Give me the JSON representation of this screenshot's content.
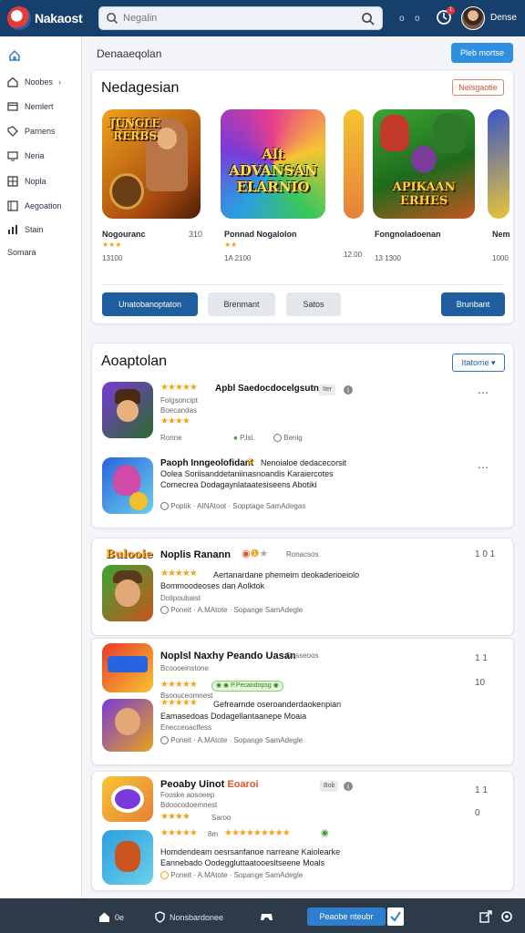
{
  "header": {
    "brand": "Nakaost",
    "search_placeholder": "Negalin",
    "dot1": "o",
    "dot2": "o",
    "notification_count": "1",
    "user_name": "Dense"
  },
  "sidebar": {
    "items": [
      {
        "label": "Noobes",
        "icon": "home-icon"
      },
      {
        "label": "Nemlert",
        "icon": "window-icon"
      },
      {
        "label": "Parnens",
        "icon": "tag-icon"
      },
      {
        "label": "Neria",
        "icon": "screen-icon"
      },
      {
        "label": "Nopla",
        "icon": "grid-icon"
      },
      {
        "label": "Aegoation",
        "icon": "list-icon"
      },
      {
        "label": "Stain",
        "icon": "chart-icon"
      },
      {
        "label": "Somara",
        "icon": ""
      }
    ]
  },
  "page": {
    "title": "Denaaeqolan",
    "top_button": "Pleb mortse"
  },
  "featured": {
    "title": "Nedagesian",
    "tag": "Nelsgaotie",
    "tiles": [
      {
        "art": "JUNGLE RERBS",
        "name": "Nogouranc",
        "num": "310",
        "meta": "13100",
        "colors": [
          "#f0a21d",
          "#7a3a10"
        ]
      },
      {
        "art": "Alt ADVANSAN ELARNIO",
        "name": "Ponnad Nogalolon",
        "num": "",
        "meta": "1A 2100",
        "colors": [
          "#d93ec7",
          "#2a63e0"
        ]
      },
      {
        "art": "",
        "name": "",
        "num": "",
        "meta": "12.00",
        "colors": [
          "#f4c430",
          "#e6803a"
        ]
      },
      {
        "art": "APIKAAN ERHES",
        "name": "Fongnoladoenan",
        "num": "",
        "meta": "13 1300",
        "colors": [
          "#3aa532",
          "#c8551f"
        ]
      },
      {
        "art": "",
        "name": "Nem",
        "num": "",
        "meta": "1000",
        "colors": [
          "#3a56c8",
          "#e8c43a"
        ]
      }
    ],
    "buttons": {
      "primary": "Unatobanoptaton",
      "secondary": "Brenmant",
      "tertiary": "Satos",
      "right": "Brunbant"
    }
  },
  "app_section": {
    "title": "Aoaptolan",
    "sort_label": "Itatome ▾",
    "rows": [
      {
        "name": "Apbl Saedocdocelgsutno",
        "pill": "Iter",
        "sub1": "Folgsoncipt",
        "sub2": "Boecandas",
        "rating": "4",
        "status_label": "Ronne",
        "status1": "P.lsl.",
        "status2": "Benig"
      },
      {
        "name": "Paoph Inngeolofidant",
        "badge": "Nenoialoe dedacecorsit",
        "line1": "Oolea Soriisanddetaniinasnoandis Karaiercotes",
        "line2": "Comecrea Dodagaynlataatesiseens Abotiki",
        "meta": "Poptik · AINAtoot · Sopptage SamAdegas"
      }
    ]
  },
  "section2": {
    "logo_text": "Bulooie",
    "name": "Noplis Ranann",
    "tag": "Ronacsos",
    "line1": "Aertanardane phemeim deokaderioeiolo",
    "line2": "Bommoodeoses dan Aolktok",
    "sub": "Dolipoubaist",
    "meta": "Poneit · A.MAtote · Sopange SamAdegle",
    "ctrl": "1 0 1"
  },
  "section3": {
    "name": "Noplsl Naxhy Peando Uasan",
    "tag": "Dosseoos",
    "sub1": "Bcoooeinstone",
    "sub2": "Bsoouceomnest",
    "green_pill": "P.Pecandopsg",
    "line1": "Gefrearnde oseroanderdaokenpian",
    "line2": "Eamasedoas Dodagellantaanepe Moaia",
    "sub3": "Enecceoaclfess",
    "meta": "Poneit · A.MAtote · Sopange SamAdegle",
    "ctrl1": "1 1",
    "ctrl2": "10"
  },
  "section4": {
    "name": "Peoaby Uinot",
    "highlight": "Eoaroi",
    "tag": "Bob",
    "sub1": "Fooske aosoeep",
    "sub2": "Bdoocodoemnest",
    "sub3": "Saroo",
    "rating_label": "8m",
    "line1": "Homdendeam oesrsanfanoe narreane Kaiolearke",
    "line2": "Eannebado Oodeggluttaatooesltseene Moals",
    "meta": "Poneit · A.MAtote · Sopange SamAdegle",
    "ctrl1": "1 1",
    "ctrl2": "0"
  },
  "bottom_bar": {
    "home": "0e",
    "shield": "Nonsbardonee",
    "cta": "Peaobe nteubr"
  }
}
